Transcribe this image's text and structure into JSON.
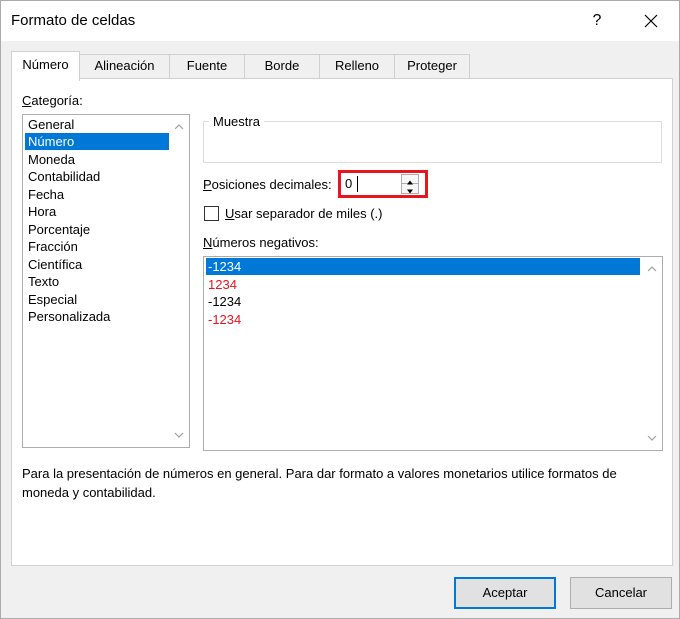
{
  "window": {
    "title": "Formato de celdas",
    "help_label": "?"
  },
  "tabs": [
    {
      "label": "Número",
      "active": true
    },
    {
      "label": "Alineación"
    },
    {
      "label": "Fuente"
    },
    {
      "label": "Borde"
    },
    {
      "label": "Relleno"
    },
    {
      "label": "Proteger"
    }
  ],
  "category": {
    "label_mnemonic": "C",
    "label_rest": "ategoría:",
    "items": [
      "General",
      "Número",
      "Moneda",
      "Contabilidad",
      "Fecha",
      "Hora",
      "Porcentaje",
      "Fracción",
      "Científica",
      "Texto",
      "Especial",
      "Personalizada"
    ],
    "selected": "Número"
  },
  "sample": {
    "legend": "Muestra",
    "value": ""
  },
  "decimals": {
    "label_mnemonic": "P",
    "label_rest": "osiciones decimales:",
    "value": "0"
  },
  "thousands_separator": {
    "label_mnemonic": "U",
    "label_rest": "sar separador de miles (.)",
    "checked": false
  },
  "negatives": {
    "label_mnemonic": "N",
    "label_rest": "úmeros negativos:",
    "items": [
      {
        "text": "-1234",
        "color": "#000000"
      },
      {
        "text": "1234",
        "color": "#e8141e"
      },
      {
        "text": "-1234",
        "color": "#000000"
      },
      {
        "text": "-1234",
        "color": "#e8141e"
      }
    ],
    "selected_index": 0
  },
  "description": "Para la presentación de números en general. Para dar formato a valores monetarios utilice formatos de moneda y contabilidad.",
  "buttons": {
    "ok": "Aceptar",
    "cancel": "Cancelar"
  },
  "colors": {
    "accent": "#0078d7",
    "highlight_border": "#e8141e",
    "negative_red": "#e8141e"
  }
}
